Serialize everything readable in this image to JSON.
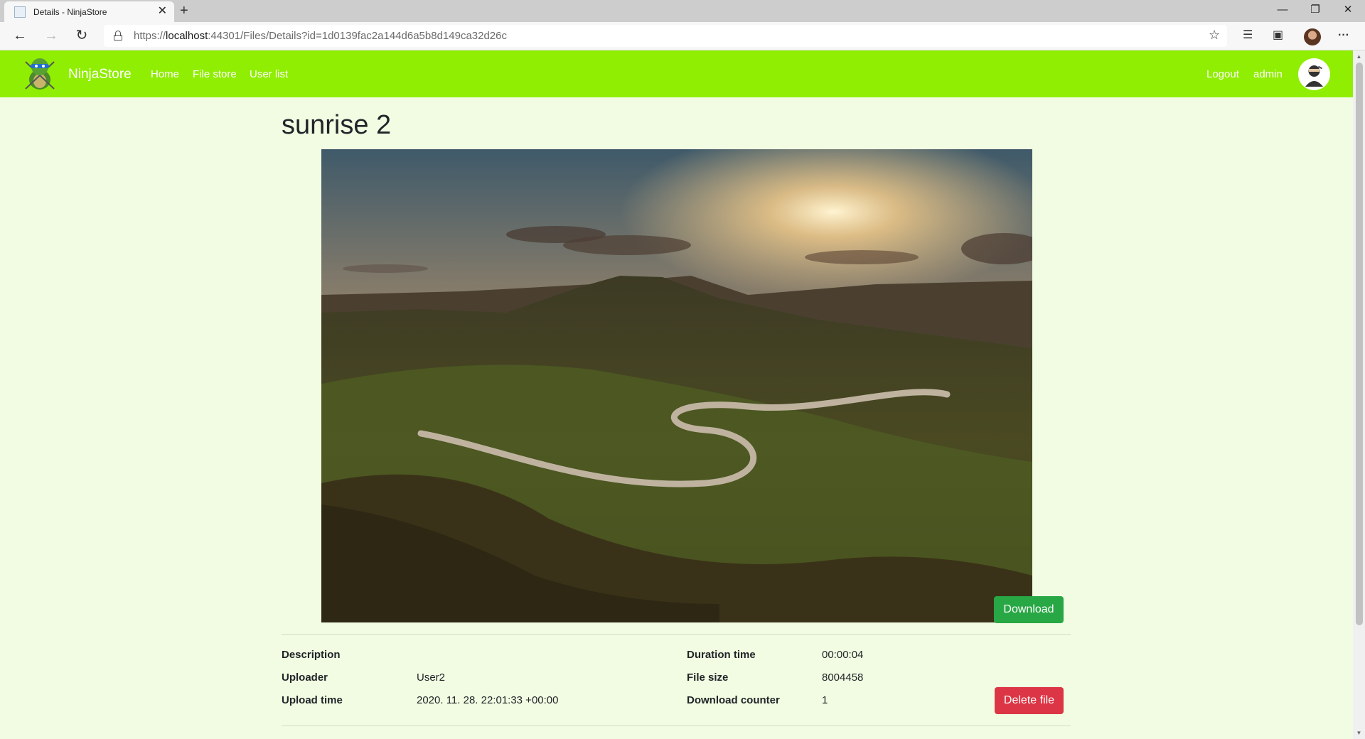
{
  "browser": {
    "tab_title": "Details - NinjaStore",
    "url_scheme": "https://",
    "url_host": "localhost",
    "url_rest": ":44301/Files/Details?id=1d0139fac2a144d6a5b8d149ca32d26c"
  },
  "navbar": {
    "brand": "NinjaStore",
    "links": [
      {
        "label": "Home"
      },
      {
        "label": "File store"
      },
      {
        "label": "User list"
      }
    ],
    "logout_label": "Logout",
    "username": "admin"
  },
  "file": {
    "title": "sunrise 2",
    "download_label": "Download",
    "delete_label": "Delete file",
    "description_label": "Description",
    "description": "",
    "uploader_label": "Uploader",
    "uploader": "User2",
    "upload_time_label": "Upload time",
    "upload_time": "2020. 11. 28. 22:01:33 +00:00",
    "duration_label": "Duration time",
    "duration": "00:00:04",
    "size_label": "File size",
    "size": "8004458",
    "download_counter_label": "Download counter",
    "download_counter": "1"
  },
  "theme": {
    "navbar_color": "#90ee02",
    "page_bg": "#f1fce2",
    "download_color": "#28a745",
    "delete_color": "#dc3545"
  }
}
